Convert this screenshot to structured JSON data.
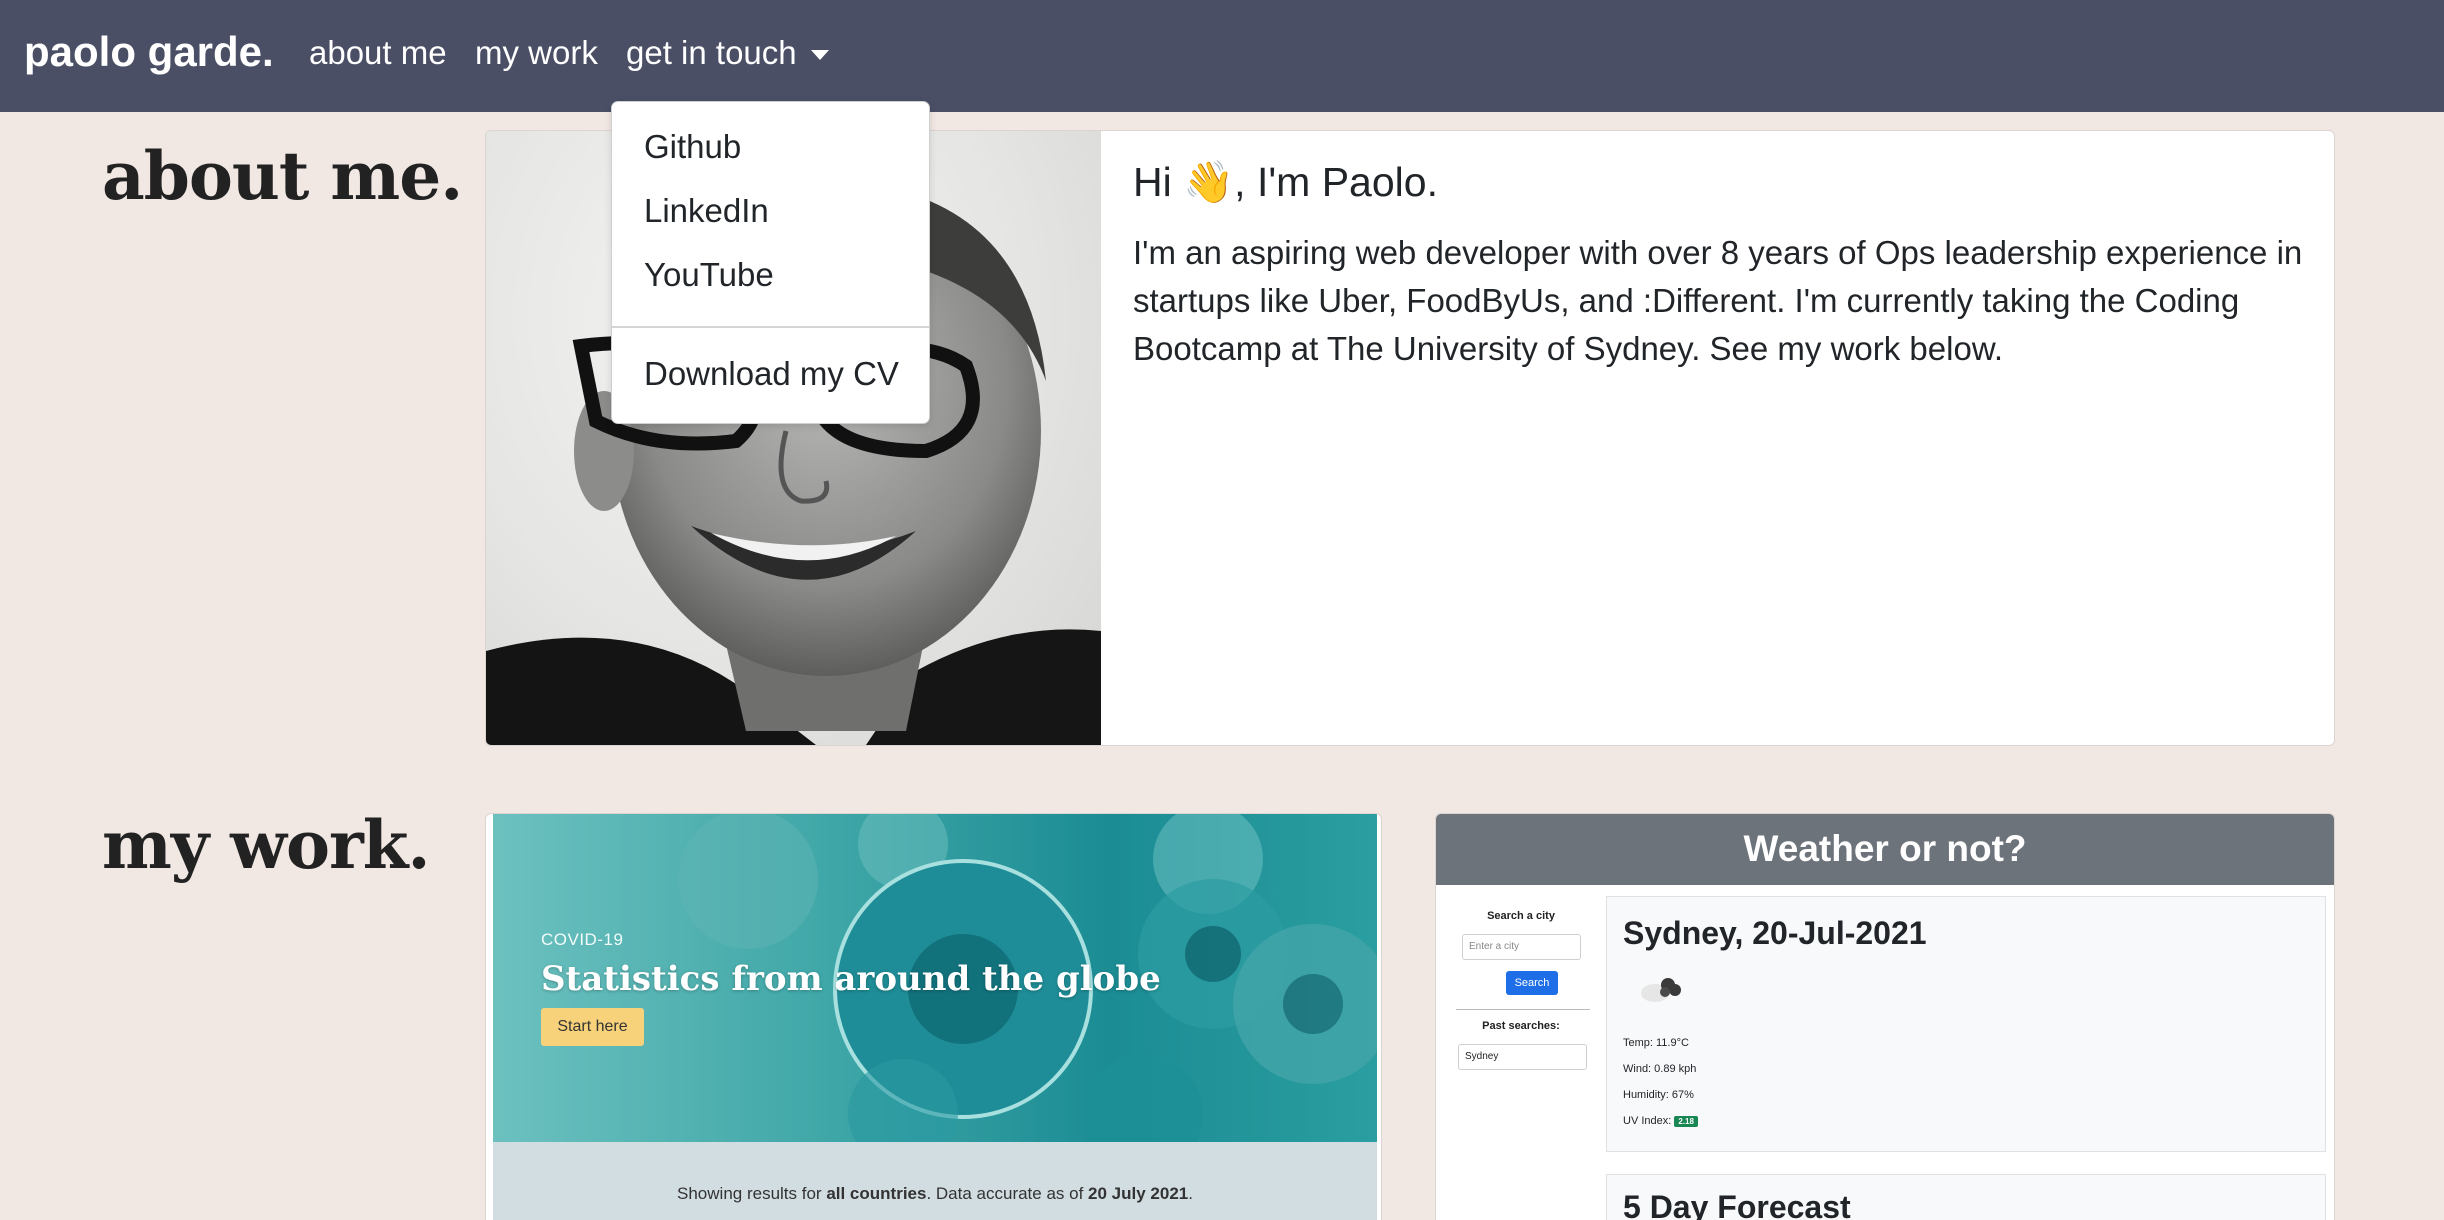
{
  "navbar": {
    "brand": "paolo garde.",
    "links": [
      "about me",
      "my work",
      "get in touch"
    ]
  },
  "dropdown": {
    "items": [
      "Github",
      "LinkedIn",
      "YouTube"
    ],
    "cv": "Download my CV"
  },
  "about": {
    "heading": "about me.",
    "greeting": "Hi 👋, I'm Paolo.",
    "body": "I'm an aspiring web developer with over 8 years of Ops leadership experience in startups like Uber, FoodByUs, and :Different. I'm currently taking the Coding Bootcamp at The University of Sydney. See my work below."
  },
  "work": {
    "heading": "my work.",
    "covid": {
      "pre_title": "COVID-19",
      "title": "Statistics from around the globe",
      "button": "Start here",
      "footer_prefix": "Showing results for ",
      "footer_bold1": "all countries",
      "footer_mid": ". Data accurate as of ",
      "footer_bold2": "20 July 2021",
      "footer_suffix": "."
    },
    "weather": {
      "title": "Weather or not?",
      "search_label": "Search a city",
      "search_placeholder": "Enter a city",
      "search_button": "Search",
      "past_label": "Past searches:",
      "past_items": [
        "Sydney"
      ],
      "city_date": "Sydney, 20-Jul-2021",
      "temp": "Temp: 11.9°C",
      "wind": "Wind: 0.89 kph",
      "humidity": "Humidity: 67%",
      "uv_label": "UV Index:",
      "uv_value": "2.18",
      "forecast_title": "5 Day Forecast"
    }
  },
  "colors": {
    "navbar": "#4a4f66",
    "page_bg": "#f1e7e3",
    "weather_header": "#6c737a",
    "uv_badge": "#198754",
    "search_button": "#1e6ee8",
    "covid_button": "#f7d27a"
  }
}
